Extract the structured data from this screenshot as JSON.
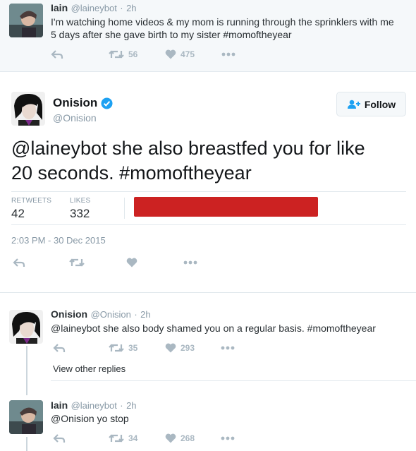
{
  "top_tweet": {
    "name": "Iain",
    "handle": "@laineybot",
    "time": "2h",
    "text_line1": "I'm watching home videos & my mom is running through the sprinklers with me",
    "text_line2": "5 days after she gave birth to my sister #momoftheyear",
    "retweets": "56",
    "likes": "475"
  },
  "main_tweet": {
    "name": "Onision",
    "handle": "@Onision",
    "follow_label": "Follow",
    "text_line1": "@laineybot she also breastfed you for like",
    "text_line2": "20 seconds. #momoftheyear",
    "retweets_label": "RETWEETS",
    "retweets": "42",
    "likes_label": "LIKES",
    "likes": "332",
    "timestamp": "2:03 PM - 30 Dec 2015"
  },
  "reply1": {
    "name": "Onision",
    "handle": "@Onision",
    "time": "2h",
    "text": "@laineybot she also body shamed you on a regular basis. #momoftheyear",
    "retweets": "35",
    "likes": "293",
    "view_other": "View other replies"
  },
  "reply2": {
    "name": "Iain",
    "handle": "@laineybot",
    "time": "2h",
    "text": "@Onision yo stop",
    "retweets": "34",
    "likes": "268"
  },
  "colors": {
    "icon_grey": "#aab8c2",
    "verified_blue": "#1da1f2",
    "redaction_red": "#cc2222"
  }
}
